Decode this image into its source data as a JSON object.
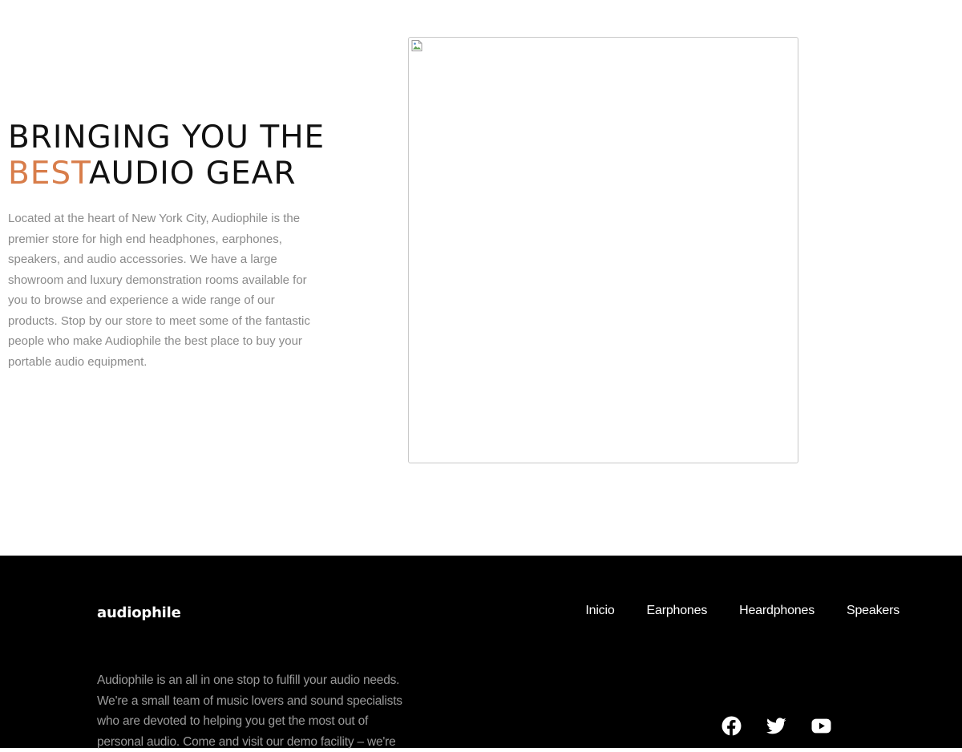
{
  "hero": {
    "headline_line1": "BRINGING YOU THE",
    "headline_accent": "BEST",
    "headline_rest": "AUDIO GEAR",
    "body": "Located at the heart of New York City, Audiophile is the premier store for high end headphones, earphones, speakers, and audio accessories. We have a large showroom and luxury demonstration rooms available for you to browse and experience a wide range of our products. Stop by our store to meet some of the fantastic people who make Audiophile the best place to buy your portable audio equipment.",
    "image_icon": "broken-image-icon"
  },
  "footer": {
    "logo": "audiophile",
    "nav": [
      "Inicio",
      "Earphones",
      "Heardphones",
      "Speakers"
    ],
    "about": "Audiophile is an all in one stop to fulfill your audio needs. We're a small team of music lovers and sound specialists who are devoted to helping you get the most out of personal audio. Come and visit our demo facility – we're",
    "social_icons": [
      "facebook-icon",
      "twitter-icon",
      "youtube-icon"
    ]
  },
  "colors": {
    "accent": "#d87d4a",
    "footer_bg": "#000000",
    "body_text": "#8a8a8a"
  }
}
